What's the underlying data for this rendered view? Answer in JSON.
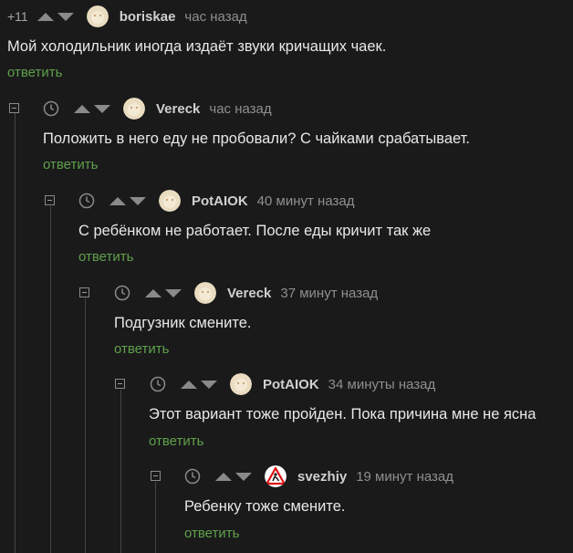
{
  "comments": [
    {
      "score": "+11",
      "author": "boriskae",
      "time": "час назад",
      "text": "Мой холодильник иногда издаёт звуки кричащих чаек.",
      "reply": "ответить",
      "avatar": "avatar-icon"
    },
    {
      "author": "Vereck",
      "time": "час назад",
      "text": "Положить в него еду не пробовали? С чайками срабатывает.",
      "reply": "ответить",
      "avatar": "avatar-icon"
    },
    {
      "author": "PotAIOK",
      "time": "40 минут назад",
      "text": "С ребёнком не работает. После еды кричит так же",
      "reply": "ответить",
      "avatar": "avatar-icon"
    },
    {
      "author": "Vereck",
      "time": "37 минут назад",
      "text": "Подгузник смените.",
      "reply": "ответить",
      "avatar": "avatar-icon"
    },
    {
      "author": "PotAIOK",
      "time": "34 минуты назад",
      "text": "Этот вариант тоже пройден. Пока причина мне не ясна",
      "reply": "ответить",
      "avatar": "avatar-icon"
    },
    {
      "author": "svezhiy",
      "time": "19 минут назад",
      "text": "Ребенку тоже смените.",
      "reply": "ответить",
      "avatar": "warning-sign-avatar-icon"
    }
  ],
  "colors": {
    "background": "#1a1a1b",
    "reply": "#5fa14a",
    "text": "#e8e8e8",
    "meta": "#8f8f8f"
  }
}
